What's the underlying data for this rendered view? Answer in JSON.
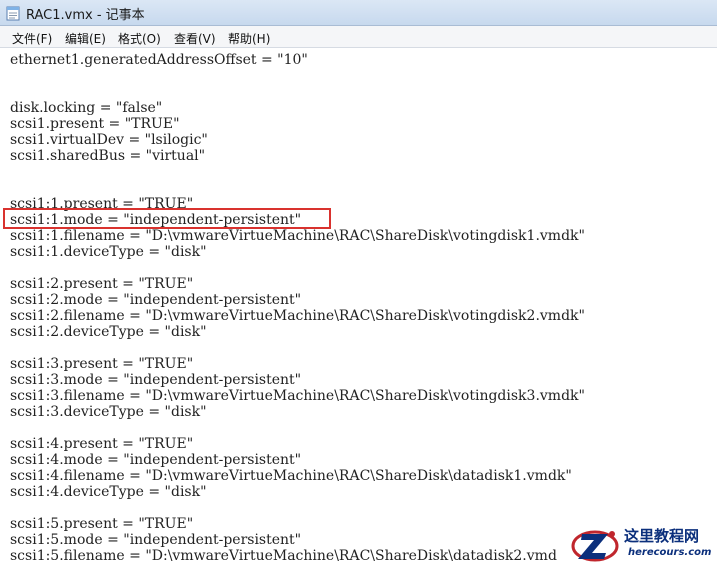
{
  "window": {
    "title": "RAC1.vmx - 记事本",
    "icon": "notepad-icon"
  },
  "menu": [
    {
      "label": "文件(F)"
    },
    {
      "label": "编辑(E)"
    },
    {
      "label": "格式(O)"
    },
    {
      "label": "查看(V)"
    },
    {
      "label": "帮助(H)"
    }
  ],
  "editor": {
    "lines": [
      "ethernet1.generatedAddressOffset = \"10\"",
      "",
      "",
      "disk.locking = \"false\"",
      "scsi1.present = \"TRUE\"",
      "scsi1.virtualDev = \"lsilogic\"",
      "scsi1.sharedBus = \"virtual\"",
      "",
      "",
      "scsi1:1.present = \"TRUE\"",
      "scsi1:1.mode = \"independent-persistent\"",
      "scsi1:1.filename = \"D:\\vmwareVirtueMachine\\RAC\\ShareDisk\\votingdisk1.vmdk\"",
      "scsi1:1.deviceType = \"disk\"",
      "",
      "scsi1:2.present = \"TRUE\"",
      "scsi1:2.mode = \"independent-persistent\"",
      "scsi1:2.filename = \"D:\\vmwareVirtueMachine\\RAC\\ShareDisk\\votingdisk2.vmdk\"",
      "scsi1:2.deviceType = \"disk\"",
      "",
      "scsi1:3.present = \"TRUE\"",
      "scsi1:3.mode = \"independent-persistent\"",
      "scsi1:3.filename = \"D:\\vmwareVirtueMachine\\RAC\\ShareDisk\\votingdisk3.vmdk\"",
      "scsi1:3.deviceType = \"disk\"",
      "",
      "scsi1:4.present = \"TRUE\"",
      "scsi1:4.mode = \"independent-persistent\"",
      "scsi1:4.filename = \"D:\\vmwareVirtueMachine\\RAC\\ShareDisk\\datadisk1.vmdk\"",
      "scsi1:4.deviceType = \"disk\"",
      "",
      "scsi1:5.present = \"TRUE\"",
      "scsi1:5.mode = \"independent-persistent\"",
      "scsi1:5.filename = \"D:\\vmwareVirtueMachine\\RAC\\ShareDisk\\datadisk2.vmd"
    ],
    "highlight_color": "#d9322e"
  },
  "watermark": {
    "title": "这里教程网",
    "domain": "herecours.com",
    "color": "#0b2f7c"
  }
}
